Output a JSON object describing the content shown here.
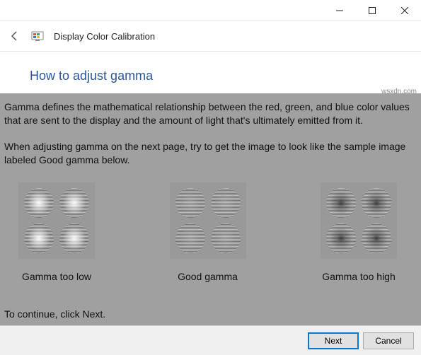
{
  "window": {
    "app_name": "Display Color Calibration"
  },
  "page": {
    "title": "How to adjust gamma",
    "description1": "Gamma defines the mathematical relationship between the red, green, and blue color values that are sent to the display and the amount of light that's ultimately emitted from it.",
    "description2": "When adjusting gamma on the next page, try to get the image to look like the sample image labeled Good gamma below.",
    "continue_hint": "To continue, click Next."
  },
  "samples": [
    {
      "label": "Gamma too low"
    },
    {
      "label": "Good gamma"
    },
    {
      "label": "Gamma too high"
    }
  ],
  "footer": {
    "next_label": "Next",
    "cancel_label": "Cancel"
  },
  "watermark": "wsxdn.com"
}
